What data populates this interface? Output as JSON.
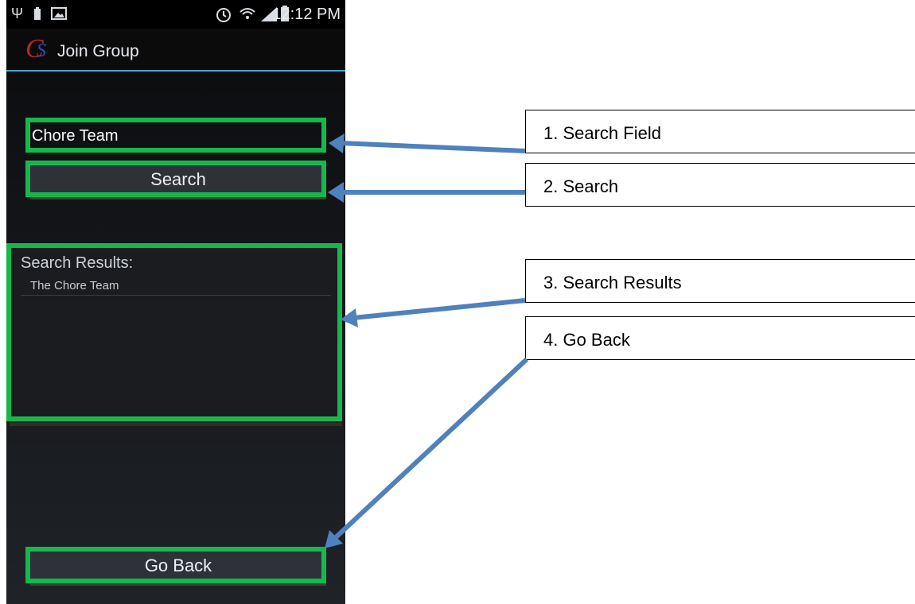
{
  "status_bar": {
    "time": "12:12 PM",
    "left_icons": [
      "usb-icon",
      "battery-saver-icon",
      "image-icon"
    ],
    "right_icons": [
      "alarm-icon",
      "wifi-icon",
      "signal-icon",
      "battery-icon"
    ]
  },
  "action_bar": {
    "logo_letters": "CS",
    "title": "Join Group"
  },
  "search": {
    "value": "Chore Team",
    "button_label": "Search"
  },
  "results": {
    "label": "Search Results:",
    "items": [
      "The Chore Team"
    ]
  },
  "footer": {
    "back_label": "Go Back"
  },
  "callouts": [
    "1. Search Field",
    "2. Search",
    "3. Search Results",
    "4. Go Back"
  ],
  "colors": {
    "highlight": "#16b84d",
    "arrow": "#4f81bd",
    "divider": "#4aa5d6"
  }
}
